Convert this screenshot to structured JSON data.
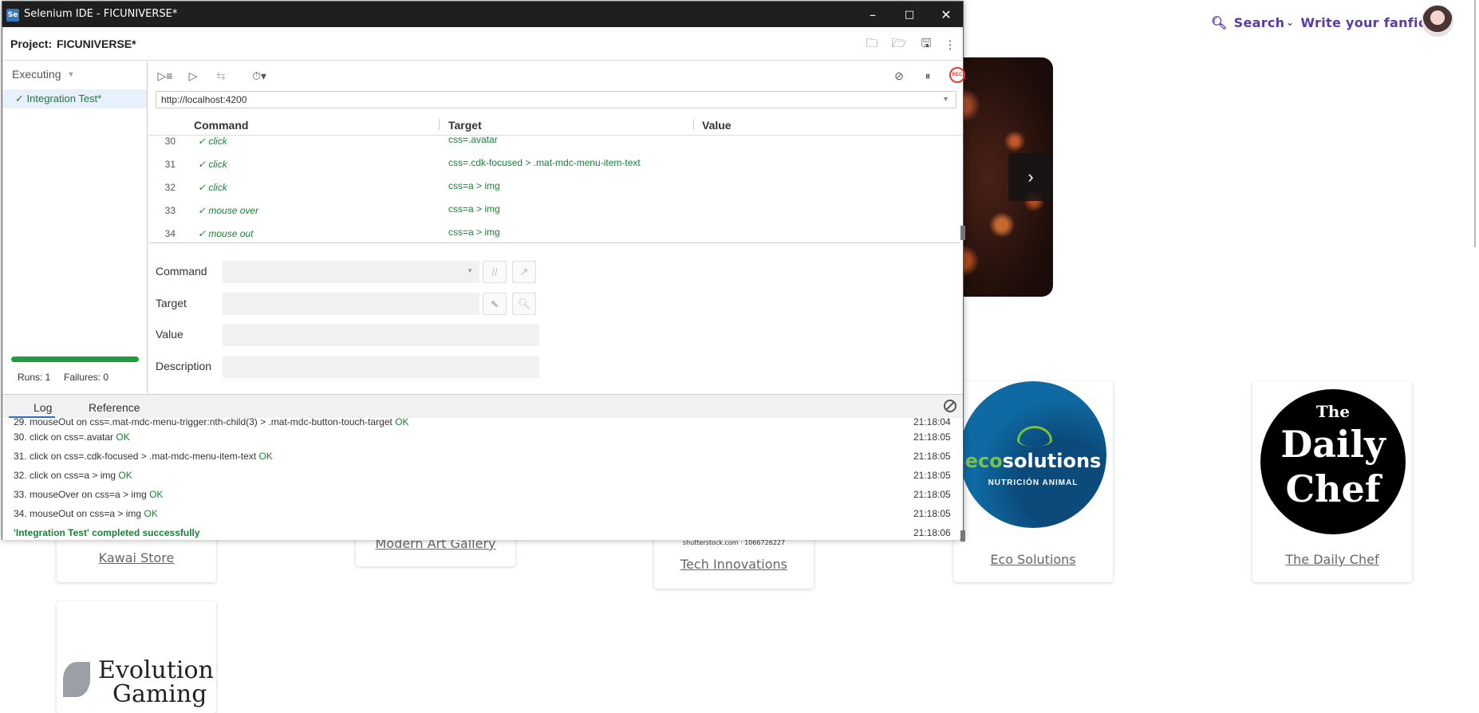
{
  "webpage": {
    "nav": {
      "search_label": "Search",
      "write_label": "Write your fanfic"
    },
    "brands": [
      {
        "name": "Kawai Store"
      },
      {
        "name": "Modern Art Gallery"
      },
      {
        "name": "Tech Innovations",
        "watermark": "shutterstock.com · 1066726227"
      },
      {
        "name": "Eco Solutions",
        "logo_text_a": "eco",
        "logo_text_b": "solutions",
        "logo_sub": "NUTRICIÓN ANIMAL"
      },
      {
        "name": "The Daily Chef",
        "logo_l1": "The",
        "logo_l2": "Daily",
        "logo_l3": "Chef"
      },
      {
        "name": "",
        "logo_l1": "Evolution",
        "logo_l2": "Gaming"
      }
    ]
  },
  "ide": {
    "window_title": "Selenium IDE - FICUNIVERSE*",
    "project_label": "Project:",
    "project_name": "FICUNIVERSE*",
    "sidebar": {
      "mode": "Executing",
      "suite": "✓ Integration Test*",
      "runs": "Runs: 1",
      "failures": "Failures: 0",
      "progress": 1.0
    },
    "url": "http://localhost:4200",
    "columns": {
      "command": "Command",
      "target": "Target",
      "value": "Value"
    },
    "commands": [
      {
        "num": "30",
        "name": "✓ click",
        "target": "css=.avatar"
      },
      {
        "num": "31",
        "name": "✓ click",
        "target": "css=.cdk-focused > .mat-mdc-menu-item-text"
      },
      {
        "num": "32",
        "name": "✓ click",
        "target": "css=a > img"
      },
      {
        "num": "33",
        "name": "✓ mouse over",
        "target": "css=a > img"
      },
      {
        "num": "34",
        "name": "✓ mouse out",
        "target": "css=a > img"
      }
    ],
    "editor": {
      "command_label": "Command",
      "target_label": "Target",
      "value_label": "Value",
      "description_label": "Description"
    },
    "log_tabs": {
      "log": "Log",
      "reference": "Reference"
    },
    "log": [
      {
        "text": "29. mouseOut on css=.mat-mdc-menu-trigger:nth-child(3) > .mat-mdc-button-touch-target",
        "status": "OK",
        "time": "21:18:04"
      },
      {
        "text": "30. click on css=.avatar",
        "status": "OK",
        "time": "21:18:05"
      },
      {
        "text": "31. click on css=.cdk-focused > .mat-mdc-menu-item-text",
        "status": "OK",
        "time": "21:18:05"
      },
      {
        "text": "32. click on css=a > img",
        "status": "OK",
        "time": "21:18:05"
      },
      {
        "text": "33. mouseOver on css=a > img",
        "status": "OK",
        "time": "21:18:05"
      },
      {
        "text": "34. mouseOut on css=a > img",
        "status": "OK",
        "time": "21:18:05"
      }
    ],
    "log_final": {
      "text": "'Integration Test' completed successfully",
      "time": "21:18:06"
    },
    "rec_label": "REC"
  }
}
